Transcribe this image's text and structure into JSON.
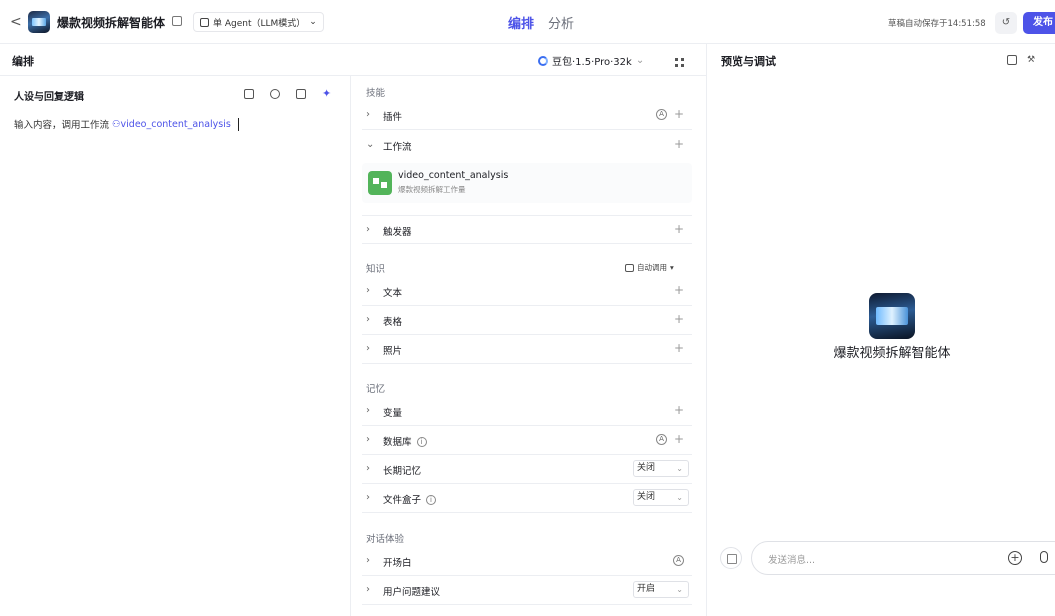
{
  "header": {
    "back": "<",
    "app_title": "爆款视频拆解智能体",
    "agent_mode": "单 Agent（LLM模式）",
    "tabs": [
      "编排",
      "分析"
    ],
    "autosave": "草稿自动保存于14:51:58",
    "publish": "发布"
  },
  "editor": {
    "title": "编排",
    "model": "豆包·1.5·Pro·32k"
  },
  "persona": {
    "title": "人设与回复逻辑",
    "text": "输入内容，调用工作流",
    "workflow_ref": "video_content_analysis"
  },
  "skills": {
    "section_skills": "技能",
    "plugins": "插件",
    "workflow": "工作流",
    "workflow_item": {
      "name": "video_content_analysis",
      "desc": "爆款视频拆解工作量"
    },
    "triggers": "触发器",
    "section_knowledge": "知识",
    "auto_call": "自动调用",
    "text": "文本",
    "table": "表格",
    "photo": "照片",
    "section_memory": "记忆",
    "variables": "变量",
    "database": "数据库",
    "long_memory": "长期记忆",
    "long_memory_value": "关闭",
    "file_box": "文件盒子",
    "file_box_value": "关闭",
    "section_dialog": "对话体验",
    "opener": "开场白",
    "suggestions": "用户问题建议",
    "suggestions_value": "开启"
  },
  "preview": {
    "title": "预览与调试",
    "bot_name": "爆款视频拆解智能体",
    "placeholder": "发送消息..."
  }
}
